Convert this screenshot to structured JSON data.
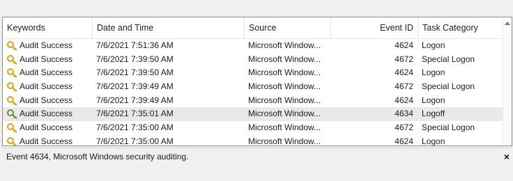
{
  "columns": {
    "keywords": "Keywords",
    "date_time": "Date and Time",
    "source": "Source",
    "event_id": "Event ID",
    "task_category": "Task Category"
  },
  "rows": [
    {
      "keywords": "Audit Success",
      "date_time": "7/6/2021 7:51:36 AM",
      "source": "Microsoft Window...",
      "event_id": "4624",
      "task_category": "Logon",
      "icon": "key-icon",
      "icon_color": "#d9a21b"
    },
    {
      "keywords": "Audit Success",
      "date_time": "7/6/2021 7:39:50 AM",
      "source": "Microsoft Window...",
      "event_id": "4672",
      "task_category": "Special Logon",
      "icon": "key-icon",
      "icon_color": "#d9a21b"
    },
    {
      "keywords": "Audit Success",
      "date_time": "7/6/2021 7:39:50 AM",
      "source": "Microsoft Window...",
      "event_id": "4624",
      "task_category": "Logon",
      "icon": "key-icon",
      "icon_color": "#d9a21b"
    },
    {
      "keywords": "Audit Success",
      "date_time": "7/6/2021 7:39:49 AM",
      "source": "Microsoft Window...",
      "event_id": "4672",
      "task_category": "Special Logon",
      "icon": "key-icon",
      "icon_color": "#d9a21b"
    },
    {
      "keywords": "Audit Success",
      "date_time": "7/6/2021 7:39:49 AM",
      "source": "Microsoft Window...",
      "event_id": "4624",
      "task_category": "Logon",
      "icon": "key-icon",
      "icon_color": "#d9a21b"
    },
    {
      "keywords": "Audit Success",
      "date_time": "7/6/2021 7:35:01 AM",
      "source": "Microsoft Window...",
      "event_id": "4634",
      "task_category": "Logoff",
      "icon": "key-icon",
      "icon_color": "#6f8f3a",
      "selected": true
    },
    {
      "keywords": "Audit Success",
      "date_time": "7/6/2021 7:35:00 AM",
      "source": "Microsoft Window...",
      "event_id": "4672",
      "task_category": "Special Logon",
      "icon": "key-icon",
      "icon_color": "#d9a21b"
    },
    {
      "keywords": "Audit Success",
      "date_time": "7/6/2021 7:35:00 AM",
      "source": "Microsoft Window...",
      "event_id": "4624",
      "task_category": "Logon",
      "icon": "key-icon",
      "icon_color": "#d9a21b"
    }
  ],
  "status_bar": {
    "text": "Event 4634, Microsoft Windows security auditing.",
    "close_label": "×"
  }
}
